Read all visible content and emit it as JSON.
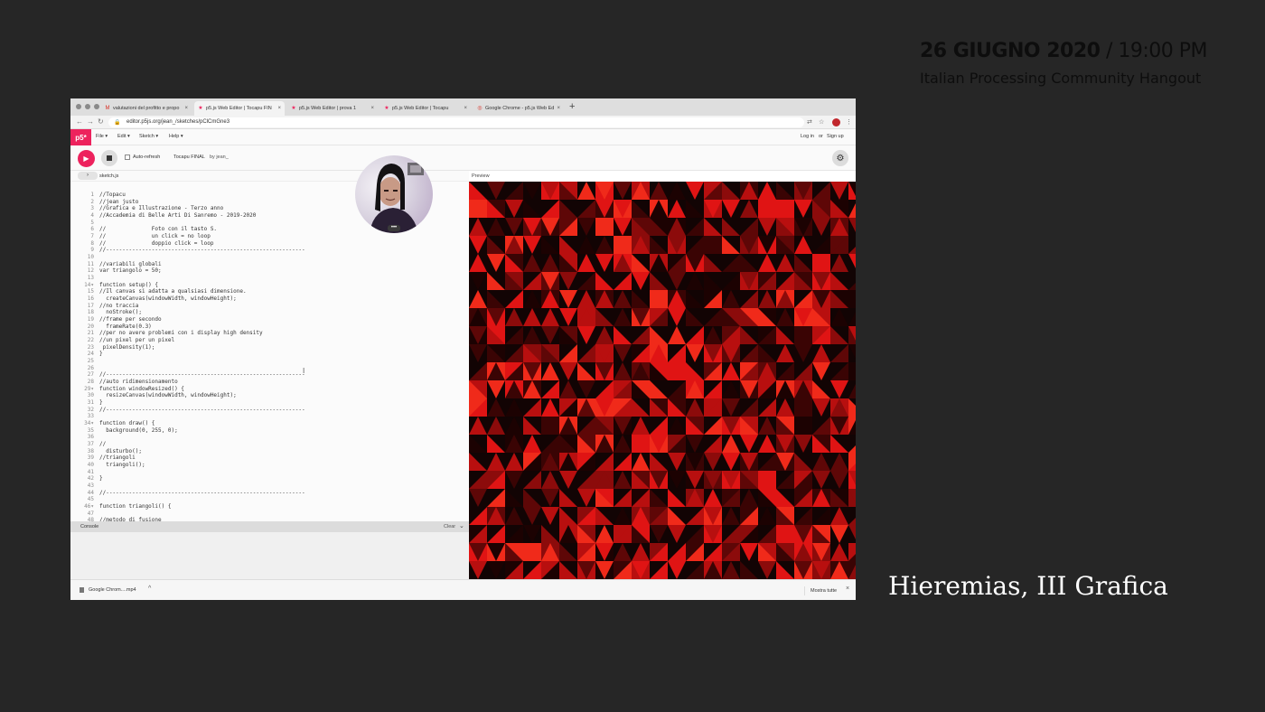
{
  "header": {
    "date_bold": "26 GIUGNO 2020",
    "time": " / 19:00 PM",
    "subtitle": "Italian Processing Community Hangout"
  },
  "caption": "Hieremias, III Grafica",
  "browser": {
    "tabs": [
      {
        "label": "valutazioni del profitto e propo",
        "icon": "gmail-icon"
      },
      {
        "label": "p5.js Web Editor | Tocapu FIN",
        "icon": "star-icon"
      },
      {
        "label": "p5.js Web Editor | prova 1",
        "icon": "star-icon"
      },
      {
        "label": "p5.js Web Editor | Tocapu",
        "icon": "star-icon"
      },
      {
        "label": "Google Chrome - p5.js Web Ed",
        "icon": "chrome-icon"
      }
    ],
    "active_tab": 1,
    "new_tab": "+",
    "url": "editor.p5js.org/jean_/sketches/pClCmGne3"
  },
  "p5": {
    "logo": "p5*",
    "menu": [
      "File ▾",
      "Edit ▾",
      "Sketch ▾",
      "Help ▾"
    ],
    "login": "Log in",
    "or": "or",
    "signup": "Sign up",
    "auto_refresh": "Auto-refresh",
    "sketch_title": "Tocapu FINAL",
    "sketch_by": "by jean_",
    "file_tab": "sketch.js",
    "preview_label": "Preview",
    "console_label": "Console",
    "clear_label": "Clear"
  },
  "code": [
    {
      "n": "1",
      "t": "//Topacu"
    },
    {
      "n": "2",
      "t": "//jean justo"
    },
    {
      "n": "3",
      "t": "//Grafica e Illustrazione - Terzo anno"
    },
    {
      "n": "4",
      "t": "//Accademia di Belle Arti Di Sanremo - 2019-2020"
    },
    {
      "n": "5",
      "t": ""
    },
    {
      "n": "6",
      "t": "//              Foto con il tasto S."
    },
    {
      "n": "7",
      "t": "//              un click = no loop"
    },
    {
      "n": "8",
      "t": "//              doppio click = loop"
    },
    {
      "n": "9",
      "t": "//-------------------------------------------------------------"
    },
    {
      "n": "10",
      "t": ""
    },
    {
      "n": "11",
      "t": "//variabili globali"
    },
    {
      "n": "12",
      "t": "var triangolo = 50;"
    },
    {
      "n": "13",
      "t": ""
    },
    {
      "n": "14▾",
      "t": "function setup() {"
    },
    {
      "n": "15",
      "t": "//Il canvas si adatta a qualsiasi dimensione."
    },
    {
      "n": "16",
      "t": "  createCanvas(windowWidth, windowHeight);"
    },
    {
      "n": "17",
      "t": "//no traccia"
    },
    {
      "n": "18",
      "t": "  noStroke();"
    },
    {
      "n": "19",
      "t": "//frame per secondo"
    },
    {
      "n": "20",
      "t": "  frameRate(0.3)"
    },
    {
      "n": "21",
      "t": "//per no avere problemi con i display high density"
    },
    {
      "n": "22",
      "t": "//un pixel per un pixel"
    },
    {
      "n": "23",
      "t": " pixelDensity(1);"
    },
    {
      "n": "24",
      "t": "}"
    },
    {
      "n": "25",
      "t": ""
    },
    {
      "n": "26",
      "t": ""
    },
    {
      "n": "27",
      "t": "//-------------------------------------------------------------"
    },
    {
      "n": "28",
      "t": "//auto ridimensionamento"
    },
    {
      "n": "29▾",
      "t": "function windowResized() {"
    },
    {
      "n": "30",
      "t": "  resizeCanvas(windowWidth, windowHeight);"
    },
    {
      "n": "31",
      "t": "}"
    },
    {
      "n": "32",
      "t": "//-------------------------------------------------------------"
    },
    {
      "n": "33",
      "t": ""
    },
    {
      "n": "34▾",
      "t": "function draw() {"
    },
    {
      "n": "35",
      "t": "  background(0, 255, 0);"
    },
    {
      "n": "36",
      "t": ""
    },
    {
      "n": "37",
      "t": "//"
    },
    {
      "n": "38",
      "t": "  disturbo();"
    },
    {
      "n": "39",
      "t": "//triangoli"
    },
    {
      "n": "40",
      "t": "  triangoli();"
    },
    {
      "n": "41",
      "t": ""
    },
    {
      "n": "42",
      "t": "}"
    },
    {
      "n": "43",
      "t": ""
    },
    {
      "n": "44",
      "t": "//-------------------------------------------------------------"
    },
    {
      "n": "45",
      "t": ""
    },
    {
      "n": "46▾",
      "t": "function triangoli() {"
    },
    {
      "n": "47",
      "t": ""
    },
    {
      "n": "48",
      "t": "//metodo di fusione"
    }
  ],
  "downloads": {
    "file": "Google Chrom....mp4",
    "chevron": "^",
    "show_all": "Mostra tutte",
    "close": "×"
  },
  "colors": {
    "background": "#262626",
    "p5_pink": "#ed225d",
    "pattern_red": "#e01414",
    "pattern_dark": "#120404"
  }
}
